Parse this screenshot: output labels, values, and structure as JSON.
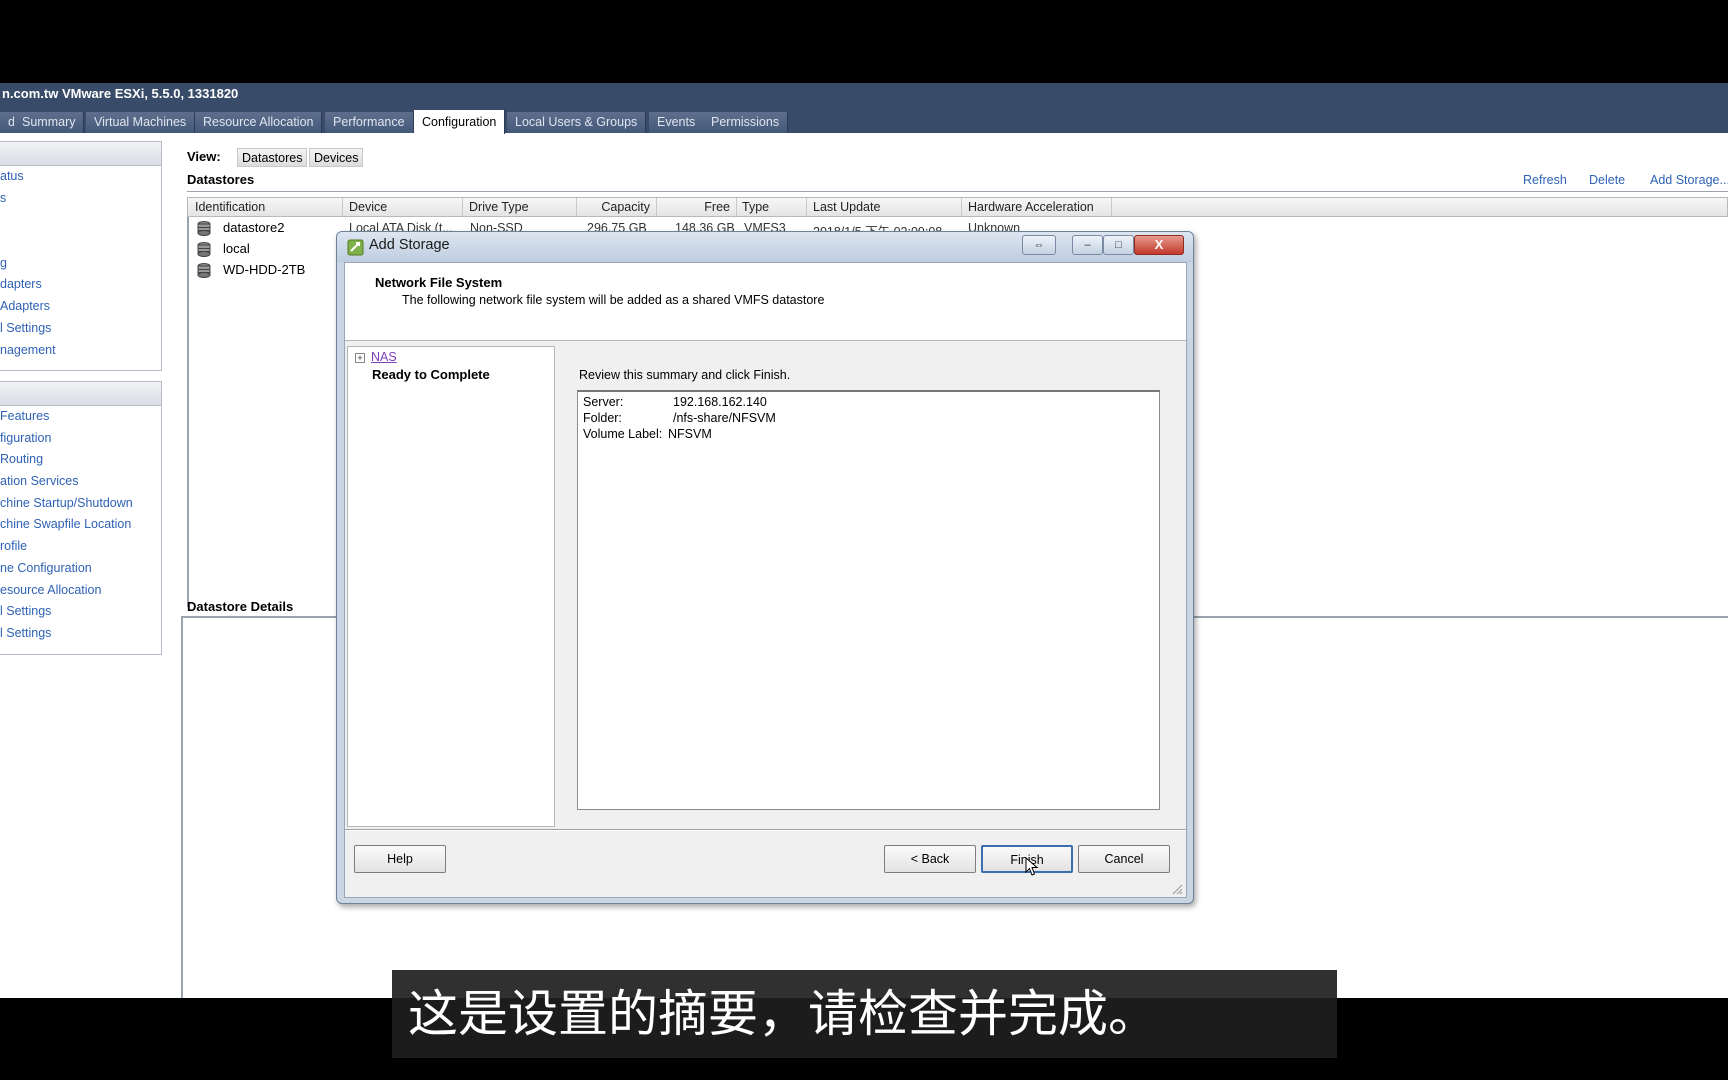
{
  "window": {
    "title": "n.com.tw VMware ESXi, 5.5.0, 1331820"
  },
  "tabs": [
    {
      "label": "d"
    },
    {
      "label": "Summary"
    },
    {
      "label": "Virtual Machines"
    },
    {
      "label": "Resource Allocation"
    },
    {
      "label": "Performance"
    },
    {
      "label": "Configuration",
      "active": true
    },
    {
      "label": "Local Users & Groups"
    },
    {
      "label": "Events"
    },
    {
      "label": "Permissions"
    }
  ],
  "sidebar": {
    "hardware_items": [
      "atus",
      "s",
      "",
      "",
      "g",
      "dapters",
      "Adapters",
      "l Settings",
      "nagement"
    ],
    "software_items": [
      "Features",
      "figuration",
      "Routing",
      "ation Services",
      "chine Startup/Shutdown",
      "chine Swapfile Location",
      "rofile",
      "ne Configuration",
      "esource Allocation",
      "l Settings",
      "l Settings"
    ]
  },
  "main": {
    "view_label": "View:",
    "view_datastores": "Datastores",
    "view_devices": "Devices",
    "datastores_title": "Datastores",
    "actions": {
      "refresh": "Refresh",
      "delete": "Delete",
      "add_storage": "Add Storage..."
    },
    "columns": [
      "Identification",
      "Device",
      "Drive Type",
      "Capacity",
      "Free",
      "Type",
      "Last Update",
      "Hardware Acceleration"
    ],
    "rows": [
      {
        "name": "datastore2",
        "device": "Local ATA Disk (t...",
        "drive_type": "Non-SSD",
        "capacity": "296.75 GB",
        "free": "148.36 GB",
        "type": "VMFS3",
        "last_update": "2018/1/5 下午 02:09:08",
        "hw_accel": "Unknown"
      },
      {
        "name": "local"
      },
      {
        "name": "WD-HDD-2TB"
      }
    ],
    "details_title": "Datastore Details"
  },
  "dialog": {
    "title": "Add Storage",
    "header_title": "Network File System",
    "header_subtitle": "The following network file system will be added as a shared VMFS datastore",
    "nav": {
      "nas": "NAS",
      "ready": "Ready to Complete",
      "expander": "+"
    },
    "review_text": "Review this summary and click Finish.",
    "summary": [
      {
        "label": "Server:",
        "value": "192.168.162.140"
      },
      {
        "label": "Folder:",
        "value": "/nfs-share/NFSVM"
      },
      {
        "label": "Volume Label:",
        "value": "NFSVM"
      }
    ],
    "buttons": {
      "help": "Help",
      "back": "< Back",
      "finish": "Finish",
      "cancel": "Cancel"
    },
    "window_buttons": {
      "minimize": "–",
      "maximize": "□",
      "close": "X",
      "extra": "⇔"
    }
  },
  "subtitle": "这是设置的摘要，请检查并完成。",
  "colors": {
    "titlebar": "#384b68",
    "link": "#2f62b5",
    "dialog_frame": "#cbd6e5"
  }
}
